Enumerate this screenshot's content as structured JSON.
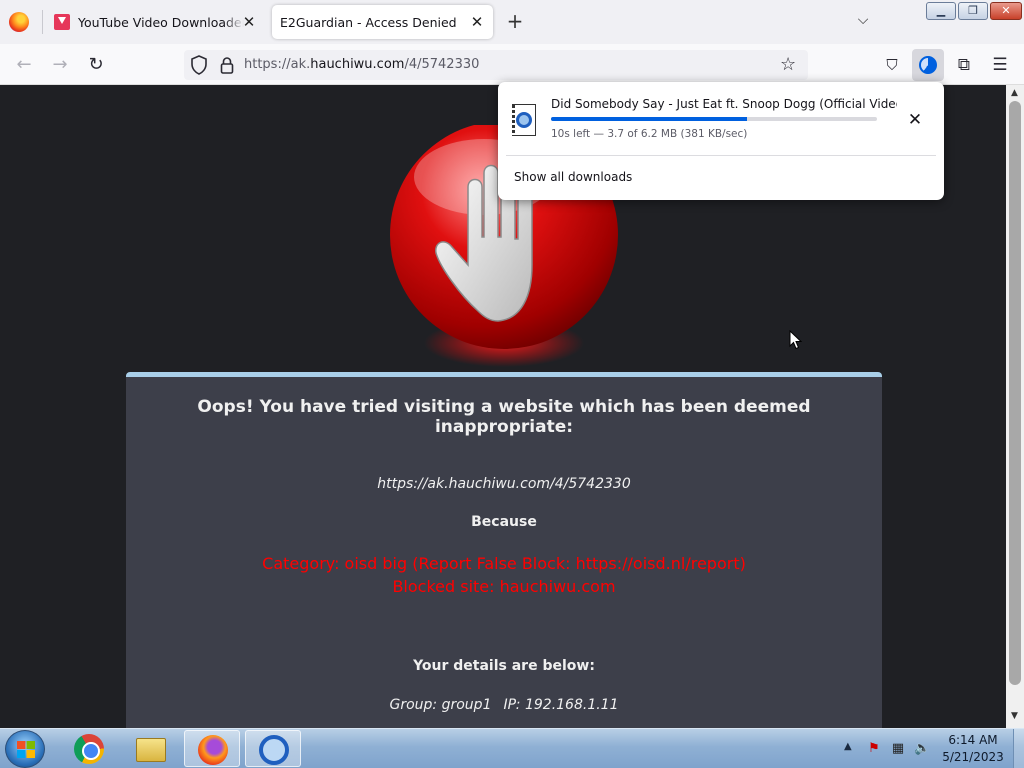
{
  "browser": {
    "tabs": [
      {
        "title": "YouTube Video Downloader - Sa",
        "active": false,
        "close": "✕"
      },
      {
        "title": "E2Guardian - Access Denied",
        "active": true,
        "close": "✕"
      }
    ],
    "new_tab": "+",
    "list_tabs": "⌵",
    "window_controls": {
      "minimize": "▁",
      "maximize": "❐",
      "close": "✕"
    },
    "url": {
      "prefix": "https://ak.",
      "host": "hauchiwu.com",
      "path": "/4/5742330"
    },
    "accent_color": "#0060df"
  },
  "page": {
    "heading": "Oops! You have tried visiting a website which has been deemed inappropriate:",
    "blocked_url": "https://ak.hauchiwu.com/4/5742330",
    "because": "Because",
    "category": "Category: oisd big (Report False Block: https://oisd.nl/report)",
    "blocked_site": "Blocked site: hauchiwu.com",
    "details_heading": "Your details are below:",
    "group": "Group: group1",
    "ip": "IP: 192.168.1.11",
    "reason_color": "#ff0000"
  },
  "downloads": {
    "file_title": "Did Somebody Say - Just Eat ft. Snoop Dogg (Official Video w- sub",
    "progress_fraction": 0.6,
    "status": "10s left — 3.7 of 6.2 MB (381 KB/sec)",
    "close": "✕",
    "show_all": "Show all downloads"
  },
  "taskbar": {
    "apps": [
      "chrome-icon",
      "explorer-icon",
      "firefox-icon",
      "quicktime-icon"
    ],
    "tray_chevron": "▲",
    "time": "6:14 AM",
    "date": "5/21/2023"
  }
}
